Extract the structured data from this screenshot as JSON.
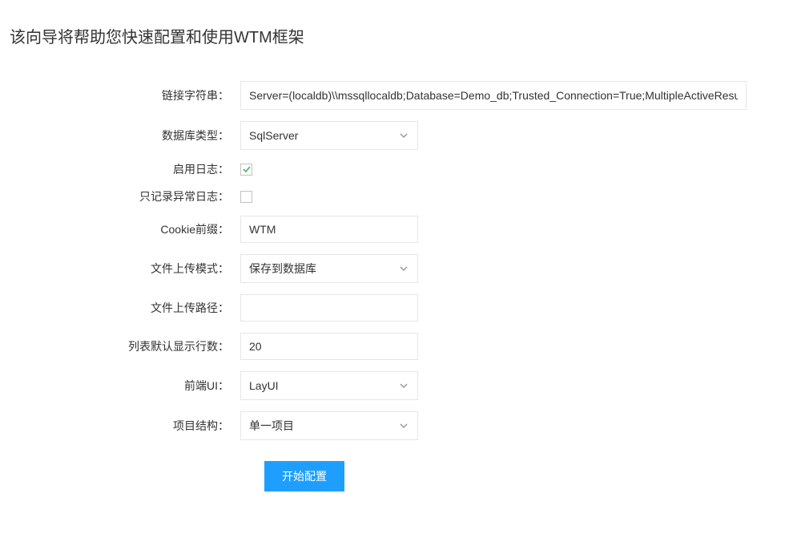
{
  "title": "该向导将帮助您快速配置和使用WTM框架",
  "labels": {
    "connString": "链接字符串：",
    "dbType": "数据库类型：",
    "enableLog": "启用日志：",
    "onlyException": "只记录异常日志：",
    "cookiePrefix": "Cookie前缀：",
    "uploadMode": "文件上传模式：",
    "uploadPath": "文件上传路径：",
    "pageRows": "列表默认显示行数：",
    "frontendUI": "前端UI：",
    "projectStructure": "项目结构："
  },
  "values": {
    "connString": "Server=(localdb)\\\\mssqllocaldb;Database=Demo_db;Trusted_Connection=True;MultipleActiveResultSets=true",
    "dbType": "SqlServer",
    "enableLog": true,
    "onlyException": false,
    "cookiePrefix": "WTM",
    "uploadMode": "保存到数据库",
    "uploadPath": "",
    "pageRows": "20",
    "frontendUI": "LayUI",
    "projectStructure": "单一项目"
  },
  "buttons": {
    "submit": "开始配置"
  }
}
